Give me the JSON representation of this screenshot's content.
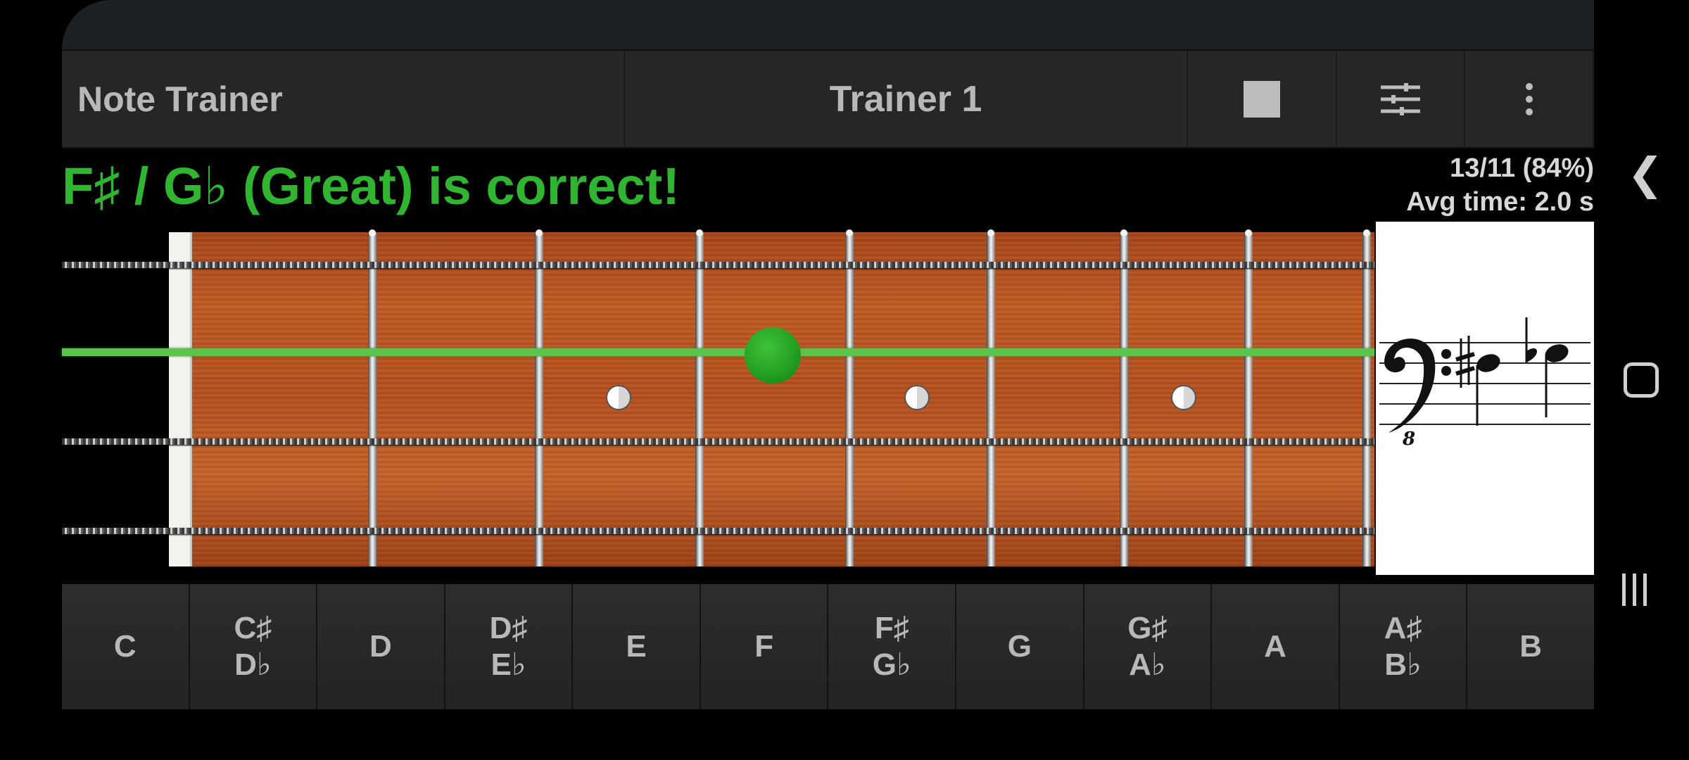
{
  "app": {
    "title": "Note Trainer",
    "trainer_name": "Trainer 1",
    "actions": [
      {
        "icon": "stop-icon"
      },
      {
        "icon": "sliders-icon"
      },
      {
        "icon": "more-vertical-icon"
      }
    ]
  },
  "status": {
    "message": "F♯ / G♭ (Great) is correct!",
    "score": "13/11 (84%)",
    "avg_time": "Avg time: 2.0 s"
  },
  "colors": {
    "correct": "#2fb52f",
    "active_string": "#59c64a",
    "fretboard_wood": "#b5501d"
  },
  "staff": {
    "clef": "bass-clef-icon",
    "octave_mark": "8"
  },
  "note_buttons": [
    {
      "top": "C",
      "bottom": ""
    },
    {
      "top": "C♯",
      "bottom": "D♭"
    },
    {
      "top": "D",
      "bottom": ""
    },
    {
      "top": "D♯",
      "bottom": "E♭"
    },
    {
      "top": "E",
      "bottom": ""
    },
    {
      "top": "F",
      "bottom": ""
    },
    {
      "top": "F♯",
      "bottom": "G♭"
    },
    {
      "top": "G",
      "bottom": ""
    },
    {
      "top": "G♯",
      "bottom": "A♭"
    },
    {
      "top": "A",
      "bottom": ""
    },
    {
      "top": "A♯",
      "bottom": "B♭"
    },
    {
      "top": "B",
      "bottom": ""
    }
  ],
  "system_nav": {
    "back_icon": "back-chevron-icon",
    "home_icon": "home-icon",
    "recents_icon": "recents-icon"
  }
}
